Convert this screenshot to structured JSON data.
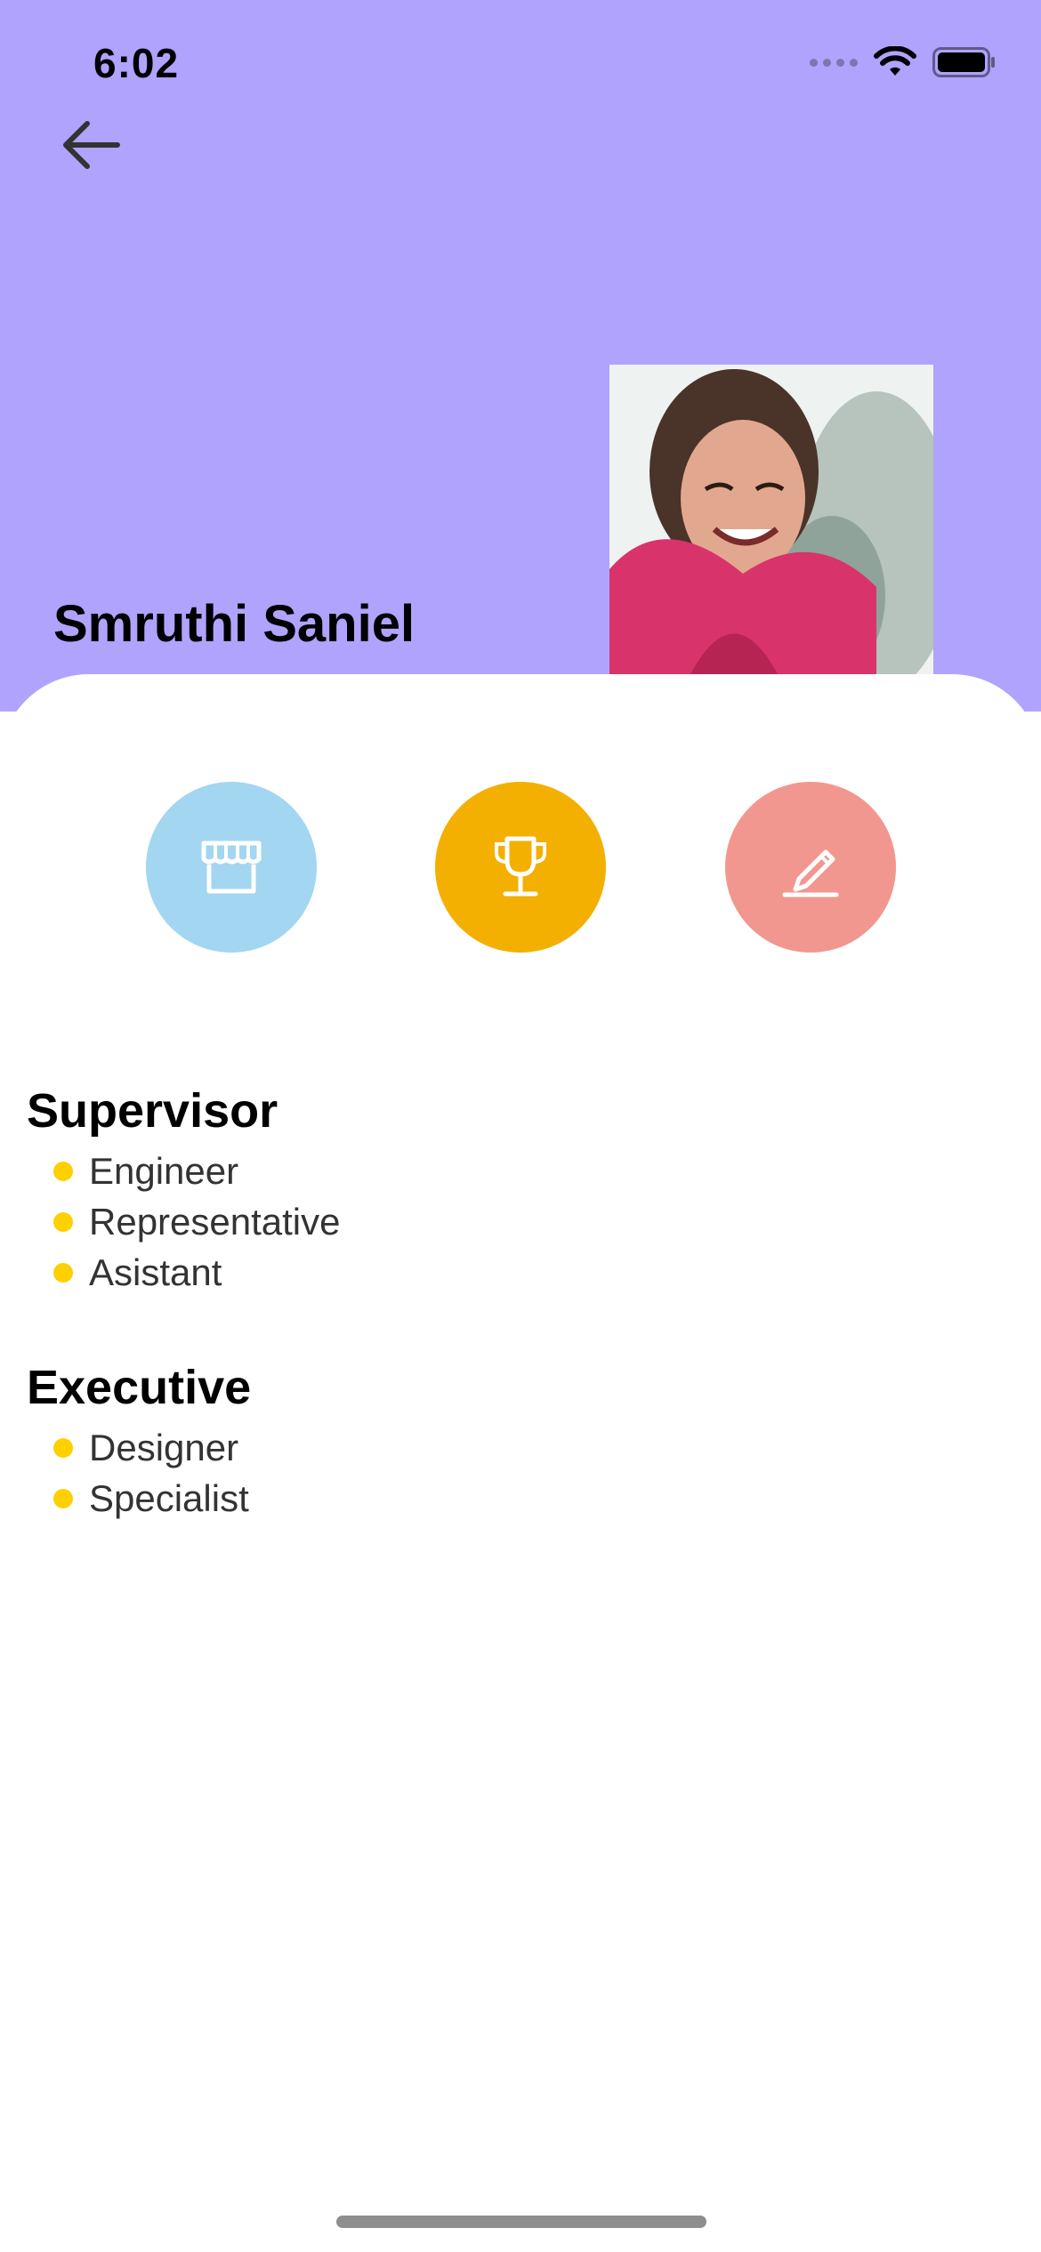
{
  "status_bar": {
    "time": "6:02"
  },
  "profile": {
    "name": "Smruthi Saniel"
  },
  "actions": [
    {
      "icon": "store-icon",
      "color": "#a2d6f1"
    },
    {
      "icon": "trophy-icon",
      "color": "#f3b000"
    },
    {
      "icon": "pencil-icon",
      "color": "#f2978f"
    }
  ],
  "sections": [
    {
      "title": "Supervisor",
      "items": [
        "Engineer",
        "Representative",
        "Asistant"
      ]
    },
    {
      "title": "Executive",
      "items": [
        "Designer",
        "Specialist"
      ]
    }
  ],
  "colors": {
    "header": "#b0a3fe",
    "bullet": "#fed000"
  }
}
